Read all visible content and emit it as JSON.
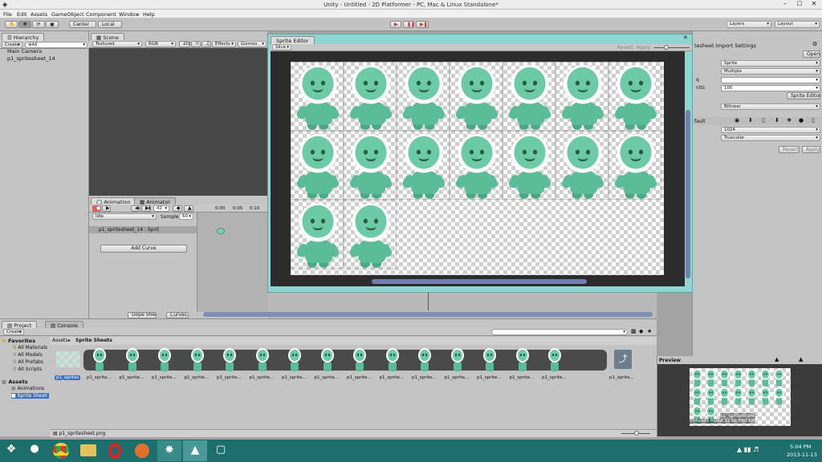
{
  "window": {
    "title": "Unity - Untitled - 2D Platformer - PC, Mac & Linux Standalone*"
  },
  "menu": [
    "File",
    "Edit",
    "Assets",
    "GameObject",
    "Component",
    "Window",
    "Help"
  ],
  "toolbar": {
    "center": "Center",
    "local": "Local",
    "layers": "Layers",
    "layout": "Layout"
  },
  "hierarchy": {
    "tab": "Hierarchy",
    "create": "Create",
    "search": "⊕All",
    "items": [
      "Main Camera",
      "p1_spritesheet_14"
    ]
  },
  "scene": {
    "tab": "Scene",
    "shading": "Textured",
    "rgb": "RGB",
    "mode2d": "2D",
    "effects": "Effects",
    "gizmos": "Gizmos"
  },
  "animation": {
    "tab": "Animation",
    "tab2": "Animator",
    "frame": "42",
    "clip": "Idle",
    "sample_label": "Sample",
    "sample": "60",
    "times": [
      "0:00",
      "0:05",
      "0:10"
    ],
    "property": "p1_spritesheet_14 : Sprit",
    "add_curve": "Add Curve",
    "dopesheet": "Dope Sheet",
    "curves": "Curves"
  },
  "sprite_editor": {
    "title": "Sprite Editor",
    "slice": "Slice",
    "revert": "Revert",
    "apply": "Apply"
  },
  "inspector": {
    "title": "tesheet Import Settings",
    "open": "Open",
    "sprite_type": "Sprite",
    "sprite_mode": "Multiple",
    "q_label": "q",
    "units_label": "nits",
    "units": "100",
    "sprite_editor_btn": "Sprite Editor",
    "filter": "Bilinear",
    "platform": "fault",
    "max_size": "1024",
    "format": "Truecolor",
    "revert": "Revert",
    "apply": "Apply"
  },
  "project": {
    "tab": "Project",
    "console": "Console",
    "create": "Create",
    "breadcrumb_root": "Assets",
    "breadcrumb_sep": "▸",
    "breadcrumb_leaf": "Sprite Sheets",
    "favorites": "Favorites",
    "fav_items": [
      "All Materials",
      "All Models",
      "All Prefabs",
      "All Scripts"
    ],
    "assets": "Assets",
    "asset_items": [
      "Animations",
      "Sprite Sheet"
    ],
    "sheet_label": "p1_sprites",
    "asset_label": "p1_sprite...",
    "status_file": "p1_spritesheet.png"
  },
  "preview": {
    "title": "Preview",
    "name": "p1_spritesheet",
    "info": "508x343 RGBA 32 bit  680 KB"
  },
  "taskbar": {
    "time": "5:04 PM",
    "date": "2013-11-13"
  },
  "colors": {
    "accent": "#5bbd98",
    "selection": "#3d6fc4",
    "play_red": "#d32a2a",
    "editor_frame": "#8fd6d2",
    "taskbar": "#1f6e6e"
  }
}
